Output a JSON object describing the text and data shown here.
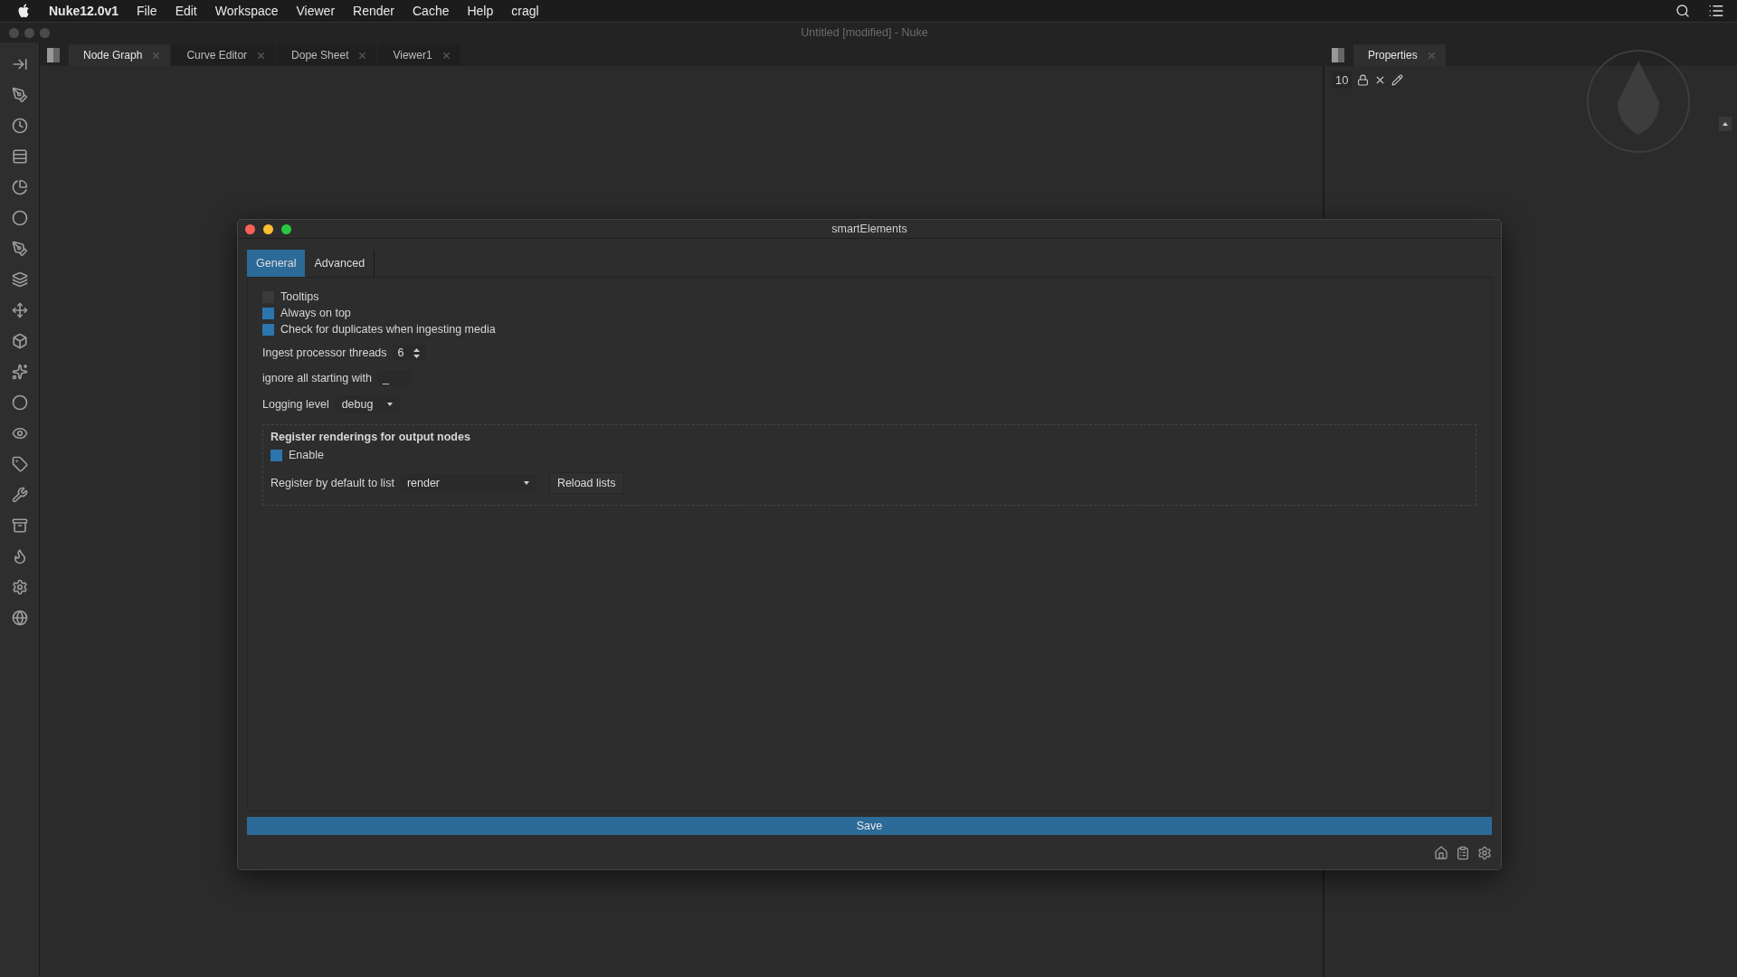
{
  "menu_bar": {
    "app_name": "Nuke12.0v1",
    "items": [
      "File",
      "Edit",
      "Workspace",
      "Viewer",
      "Render",
      "Cache",
      "Help",
      "cragl"
    ]
  },
  "window": {
    "title": "Untitled [modified] - Nuke"
  },
  "tabs": [
    {
      "label": "Node Graph",
      "selected": true
    },
    {
      "label": "Curve Editor",
      "selected": false
    },
    {
      "label": "Dope Sheet",
      "selected": false
    },
    {
      "label": "Viewer1",
      "selected": false
    }
  ],
  "properties": {
    "tab": "Properties",
    "max_panels": "10"
  },
  "dialog": {
    "title": "smartElements",
    "tabs": [
      {
        "label": "General",
        "selected": true
      },
      {
        "label": "Advanced",
        "selected": false
      }
    ],
    "checkboxes": [
      {
        "label": "Tooltips",
        "checked": false
      },
      {
        "label": "Always on top",
        "checked": true
      },
      {
        "label": "Check for duplicates when ingesting media",
        "checked": true
      }
    ],
    "threads": {
      "label": "Ingest processor threads",
      "value": "6"
    },
    "ignore": {
      "label": "ignore all starting with",
      "value": "_"
    },
    "logging": {
      "label": "Logging level",
      "value": "debug"
    },
    "group": {
      "title": "Register renderings for output nodes",
      "enable": {
        "label": "Enable",
        "checked": true
      },
      "list_label": "Register by default to list",
      "list_value": "render",
      "reload": "Reload lists"
    },
    "save": "Save"
  }
}
